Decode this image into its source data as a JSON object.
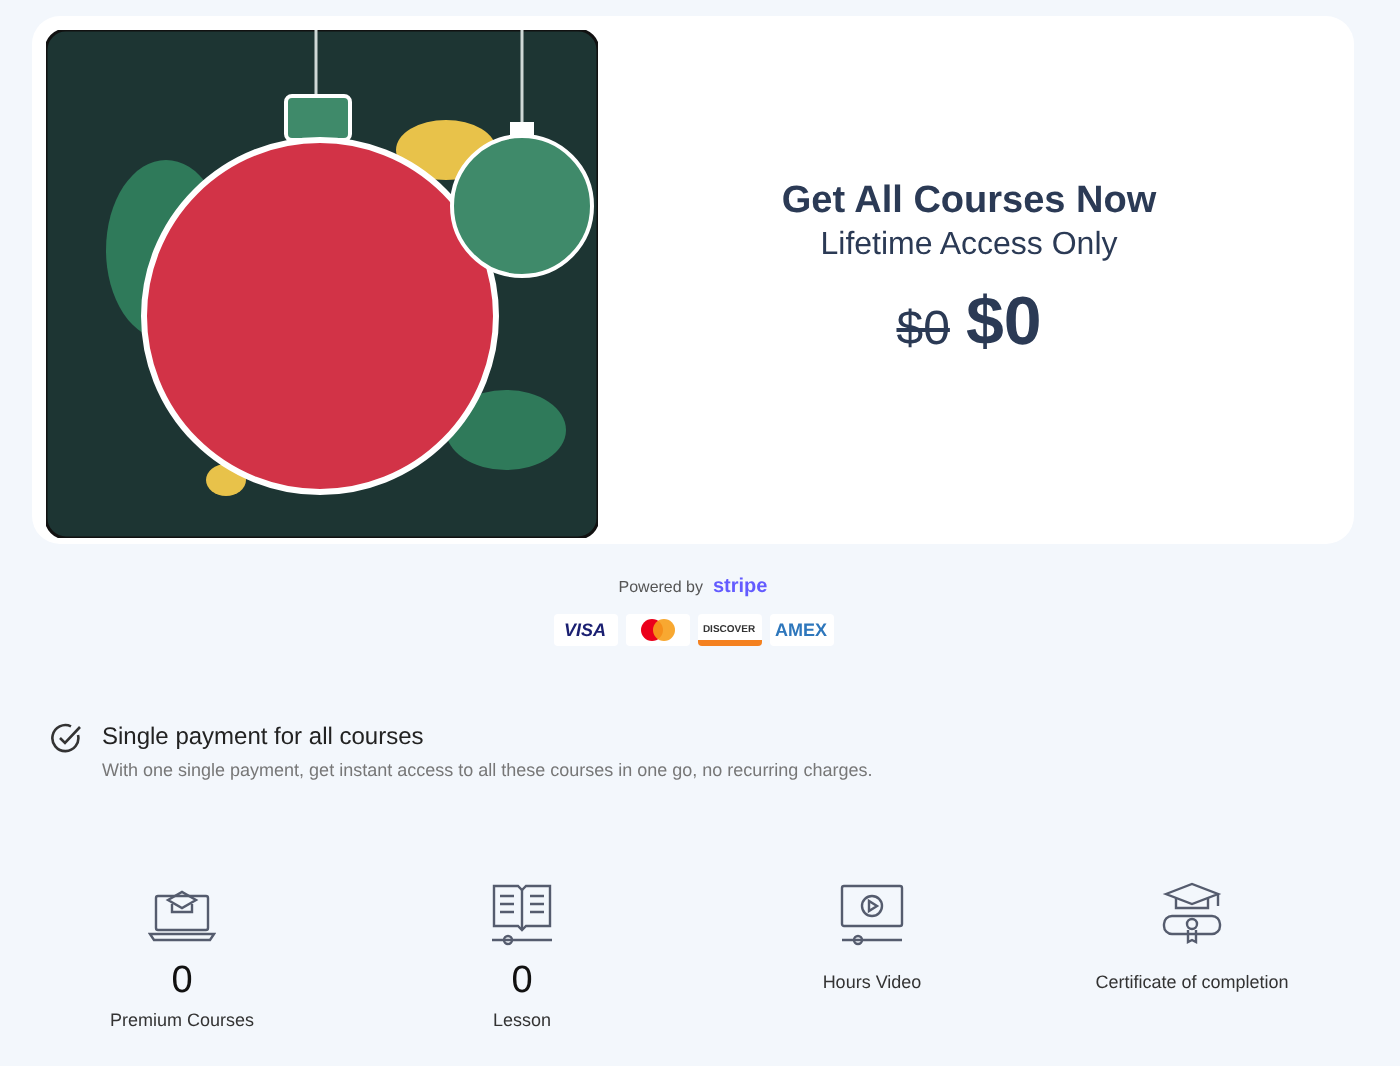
{
  "offer": {
    "title": "Get All Courses Now",
    "subtitle": "Lifetime Access Only",
    "old_price": "$0",
    "price": "$0"
  },
  "payment": {
    "powered_by": "Powered by",
    "provider": "stripe",
    "cards": [
      {
        "kind": "visa",
        "label": "VISA"
      },
      {
        "kind": "mastercard"
      },
      {
        "kind": "discover",
        "label": "DISCOVER"
      },
      {
        "kind": "amex",
        "label": "AMEX"
      }
    ]
  },
  "feature": {
    "title": "Single payment for all courses",
    "description": "With one single payment, get instant access to all these courses in one go, no recurring charges."
  },
  "stats": [
    {
      "kind": "courses",
      "value": "0",
      "label": "Premium Courses"
    },
    {
      "kind": "lesson",
      "value": "0",
      "label": "Lesson"
    },
    {
      "kind": "video",
      "label": "Hours Video"
    },
    {
      "kind": "certificate",
      "label": "Certificate of completion"
    }
  ]
}
